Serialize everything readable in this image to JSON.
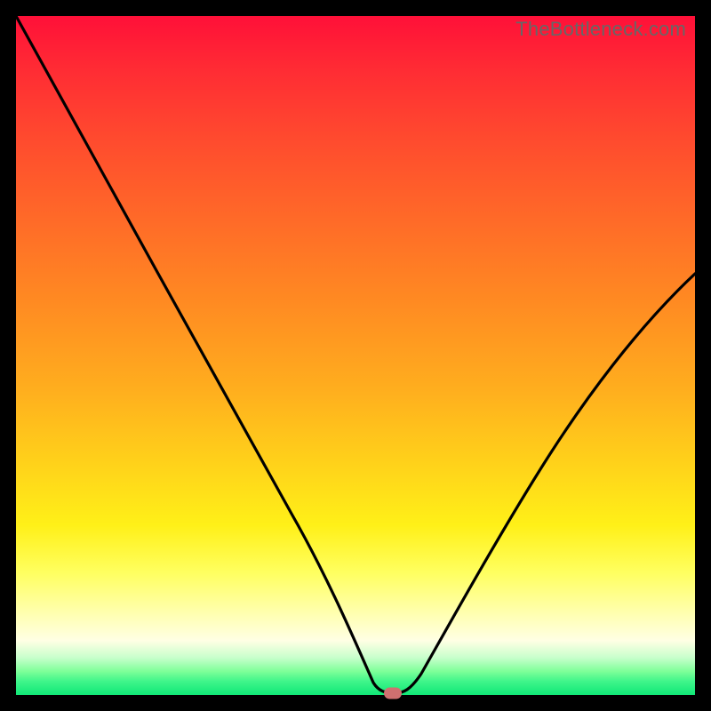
{
  "watermark": "TheBottleneck.com",
  "colors": {
    "frame_bg": "#000000",
    "watermark": "#676767",
    "curve_stroke": "#000000",
    "marker_fill": "#cf7070",
    "gradient_top": "#ff1038",
    "gradient_bottom": "#10e877"
  },
  "chart_data": {
    "type": "line",
    "title": "",
    "xlabel": "",
    "ylabel": "",
    "xlim_pct": [
      0,
      100
    ],
    "ylim_pct": [
      0,
      100
    ],
    "x": [
      0,
      4,
      8,
      12,
      16,
      20,
      24,
      28,
      32,
      36,
      40,
      44,
      48,
      50,
      52,
      54,
      55.5,
      57,
      60,
      64,
      68,
      72,
      76,
      80,
      84,
      88,
      92,
      96,
      100
    ],
    "y": [
      100,
      93,
      86,
      79,
      73,
      66,
      59,
      52,
      45,
      38,
      30,
      22,
      12,
      6,
      2,
      0.5,
      0.5,
      1.5,
      5,
      12,
      19,
      26,
      33,
      39,
      45,
      50,
      55,
      59,
      63
    ],
    "marker": {
      "x_pct": 55.5,
      "y_pct": 0.3
    },
    "note": "Values are percentages of plot width/height; y measured upward from bottom of gradient plot area."
  }
}
